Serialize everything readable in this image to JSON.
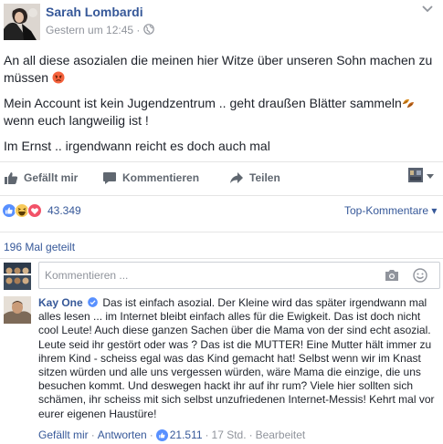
{
  "post": {
    "author": "Sarah Lombardi",
    "timestamp": "Gestern um 12:45",
    "separator": "·",
    "paragraphs": {
      "p1": "An all diese asozialen die meinen hier Witze über unseren Sohn machen zu müssen",
      "p2a": "Mein Account ist kein Jugendzentrum .. geht draußen Blätter sammeln",
      "p2b": "wenn euch langweilig ist !",
      "p3": "Im Ernst .. irgendwann reicht es doch auch mal"
    },
    "icons": {
      "audience": "globe-icon",
      "options": "chevron-down-icon",
      "angry_emoji": "angry-face-icon",
      "leaves_emoji": "fallen-leaf-icon"
    }
  },
  "actions": {
    "like": "Gefällt mir",
    "comment": "Kommentieren",
    "share": "Teilen"
  },
  "reactions": {
    "count": "43.349",
    "types": [
      "like",
      "haha",
      "love"
    ],
    "top_comments_label": "Top-Kommentare",
    "top_comments_caret": "▾"
  },
  "shares": {
    "label": "196 Mal geteilt"
  },
  "comment_box": {
    "placeholder": "Kommentieren ..."
  },
  "comment": {
    "author": "Kay One",
    "text": "Das ist einfach asozial. Der Kleine wird das später irgendwann mal alles lesen ... im Internet bleibt einfach alles für die Ewigkeit. Das ist doch nicht cool Leute! Auch diese ganzen Sachen über die Mama von der sind echt asozial. Leute seid ihr gestört oder was ? Das ist die MUTTER! Eine Mutter hält immer zu ihrem Kind - scheiss egal was das Kind gemacht hat! Selbst wenn wir im Knast sitzen würden und alle uns vergessen würden, wäre Mama die einzige, die uns besuchen kommt. Und deswegen hackt ihr auf ihr rum? Viele hier sollten sich schämen, ihr scheiss mit sich selbst unzufriedenen Internet-Messis! Kehrt mal vor eurer eigenen Haustüre!",
    "like": "Gefällt mir",
    "reply": "Antworten",
    "likes": "21.511",
    "time": "17 Std.",
    "edited": "Bearbeitet",
    "dot": "·"
  },
  "colors": {
    "link": "#365899",
    "text": "#1d2129",
    "muted": "#90949c",
    "action": "#606770",
    "like_blue": "#5890ff",
    "love_red": "#f25268",
    "haha_yellow": "#f7c95a"
  }
}
